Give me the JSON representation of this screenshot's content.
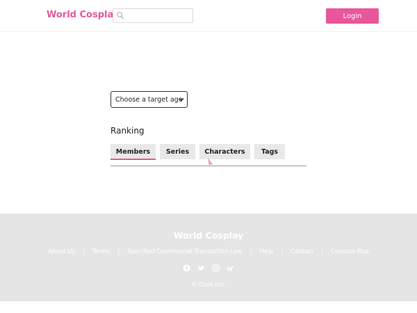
{
  "header": {
    "logo": "World Cosplay",
    "search_placeholder": "",
    "login_label": "Login",
    "search_icon": "search-icon"
  },
  "filters": {
    "age_select": {
      "selected": "Choose a target age",
      "options": [
        "Choose a target age"
      ]
    }
  },
  "ranking": {
    "title": "Ranking",
    "tabs": [
      {
        "label": "Members",
        "active": true
      },
      {
        "label": "Series",
        "active": false
      },
      {
        "label": "Characters",
        "active": false
      },
      {
        "label": "Tags",
        "active": false
      }
    ]
  },
  "footer": {
    "logo": "World Cosplay",
    "links": [
      {
        "label": "About Us"
      },
      {
        "label": "Terms"
      },
      {
        "label": "Specified Commercial Transaction Law"
      },
      {
        "label": "Help"
      },
      {
        "label": "Contact"
      },
      {
        "label": "Curecos Plus"
      }
    ],
    "separator": "|",
    "social_icons": [
      "facebook-icon",
      "twitter-icon",
      "instagram-icon",
      "weibo-icon"
    ],
    "copyright": "© Cure Inc."
  },
  "colors": {
    "accent": "#e8579b",
    "footer_bg": "#e5e5e5",
    "tab_bg": "#e9e9e9"
  }
}
